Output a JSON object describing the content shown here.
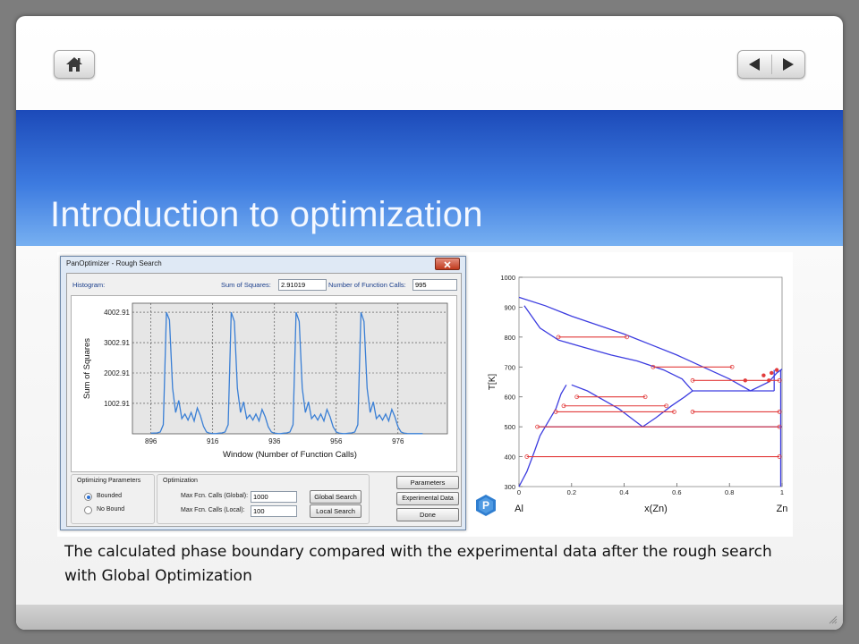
{
  "slide": {
    "title": "Introduction to optimization",
    "caption": "The calculated phase boundary compared with the experimental data after the rough search with Global Optimization"
  },
  "nav": {
    "home_icon": "home-icon",
    "prev_icon": "triangle-left-icon",
    "next_icon": "triangle-right-icon"
  },
  "window": {
    "title": "PanOptimizer - Rough Search",
    "histogram_label": "Histogram:",
    "sum_of_squares_label": "Sum of Squares:",
    "sum_of_squares_value": "2.91019",
    "function_calls_label": "Number of Function Calls:",
    "function_calls_value": "995",
    "optimizing_parameters_label": "Optimizing Parameters",
    "radio_bounded": "Bounded",
    "radio_no_bound": "No Bound",
    "optimization_label": "Optimization",
    "max_global_label": "Max Fcn. Calls (Global):",
    "max_global_value": "1000",
    "max_local_label": "Max Fcn. Calls (Local):",
    "max_local_value": "100",
    "btn_global": "Global Search",
    "btn_local": "Local Search",
    "btn_parameters": "Parameters",
    "btn_experimental": "Experimental Data",
    "btn_done": "Done"
  },
  "chart_data": [
    {
      "type": "line",
      "xlabel": "Window (Number of Function Calls)",
      "ylabel": "Sum of Squares",
      "xticks": [
        "896",
        "916",
        "936",
        "956",
        "976"
      ],
      "yticks": [
        "4002.91",
        "3002.91",
        "2002.91",
        "1002.91"
      ],
      "xlim": [
        890,
        992
      ],
      "ylim": [
        0,
        4300
      ],
      "series": [
        {
          "x": [
            896,
            898,
            899,
            900,
            901,
            902,
            903,
            904,
            905,
            906,
            907,
            908,
            909,
            910,
            911,
            912,
            913,
            914,
            915,
            916,
            917,
            918,
            919,
            920,
            921,
            922,
            923,
            924,
            925,
            926,
            927,
            928,
            929,
            930,
            931,
            932,
            933,
            934,
            935,
            936,
            937,
            938,
            939,
            940,
            941,
            942,
            943,
            944,
            945,
            946,
            947,
            948,
            949,
            950,
            951,
            952,
            953,
            954,
            955,
            956,
            957,
            958,
            959,
            960,
            961,
            962,
            963,
            964,
            965,
            966,
            967,
            968,
            969,
            970,
            971,
            972,
            973,
            974,
            975,
            976,
            977,
            978,
            979,
            980,
            981,
            982,
            983,
            984
          ],
          "y": [
            20,
            30,
            60,
            300,
            4000,
            3750,
            1500,
            700,
            1100,
            500,
            650,
            450,
            700,
            420,
            850,
            600,
            250,
            60,
            20,
            10,
            5,
            20,
            30,
            60,
            300,
            4000,
            3700,
            1500,
            700,
            1050,
            500,
            620,
            450,
            650,
            420,
            800,
            560,
            230,
            60,
            20,
            10,
            5,
            20,
            30,
            60,
            300,
            4000,
            3700,
            1500,
            700,
            1050,
            500,
            620,
            450,
            650,
            420,
            800,
            560,
            230,
            60,
            20,
            10,
            5,
            20,
            30,
            60,
            300,
            4000,
            3700,
            1500,
            700,
            1050,
            500,
            620,
            450,
            650,
            420,
            800,
            560,
            230,
            60,
            20,
            10,
            5,
            5,
            5,
            5,
            5
          ]
        }
      ]
    },
    {
      "type": "line",
      "xlabel": "x(Zn)",
      "ylabel": "T[K]",
      "xlim": [
        0,
        1
      ],
      "ylim": [
        300,
        1000
      ],
      "xticks": [
        "0",
        "0.2",
        "0.4",
        "0.6",
        "0.8",
        "1"
      ],
      "yticks": [
        "300",
        "400",
        "500",
        "600",
        "700",
        "800",
        "900",
        "1000"
      ],
      "x_end_labels": [
        "Al",
        "Zn"
      ],
      "colors": {
        "calculated": "#3d3de0",
        "experimental": "#e23c3c"
      },
      "calculated_boundaries": [
        {
          "x": [
            0,
            0.1,
            0.2,
            0.3,
            0.4,
            0.5,
            0.6,
            0.7,
            0.8,
            0.88,
            0.95,
            0.98,
            1.0
          ],
          "y": [
            933,
            905,
            870,
            840,
            810,
            775,
            740,
            700,
            660,
            620,
            650,
            680,
            693
          ]
        },
        {
          "x": [
            0.02,
            0.08,
            0.15,
            0.25,
            0.35,
            0.45,
            0.55,
            0.62,
            0.66
          ],
          "y": [
            905,
            830,
            790,
            765,
            740,
            720,
            690,
            660,
            620
          ]
        },
        {
          "x": [
            0.0,
            0.03,
            0.06,
            0.08,
            0.1,
            0.14,
            0.16,
            0.18
          ],
          "y": [
            300,
            350,
            420,
            470,
            500,
            560,
            610,
            640
          ]
        },
        {
          "x": [
            0.2,
            0.26,
            0.32,
            0.38,
            0.44,
            0.47
          ],
          "y": [
            640,
            620,
            590,
            560,
            520,
            500
          ]
        },
        {
          "x": [
            0.47,
            0.52,
            0.58,
            0.63,
            0.66
          ],
          "y": [
            500,
            530,
            570,
            600,
            620
          ]
        },
        {
          "x": [
            0.08,
            1.0
          ],
          "y": [
            500,
            500
          ]
        },
        {
          "x": [
            0.66,
            0.97
          ],
          "y": [
            620,
            620
          ]
        },
        {
          "x": [
            0.97,
            0.97
          ],
          "y": [
            620,
            690
          ]
        },
        {
          "x": [
            0.995,
            0.995
          ],
          "y": [
            300,
            690
          ]
        }
      ],
      "experimental_tielines": [
        {
          "x": [
            0.15,
            0.41
          ],
          "y": [
            800,
            800
          ]
        },
        {
          "x": [
            0.51,
            0.81
          ],
          "y": [
            700,
            700
          ]
        },
        {
          "x": [
            0.22,
            0.48
          ],
          "y": [
            600,
            600
          ]
        },
        {
          "x": [
            0.17,
            0.56
          ],
          "y": [
            570,
            570
          ]
        },
        {
          "x": [
            0.14,
            0.59
          ],
          "y": [
            550,
            550
          ]
        },
        {
          "x": [
            0.07,
            0.99
          ],
          "y": [
            500,
            500
          ]
        },
        {
          "x": [
            0.03,
            0.99
          ],
          "y": [
            400,
            400
          ]
        },
        {
          "x": [
            0.66,
            0.99
          ],
          "y": [
            655,
            655
          ]
        },
        {
          "x": [
            0.66,
            0.99
          ],
          "y": [
            550,
            550
          ]
        }
      ],
      "experimental_points": [
        {
          "x": 0.86,
          "y": 655
        },
        {
          "x": 0.95,
          "y": 655
        },
        {
          "x": 0.93,
          "y": 672
        },
        {
          "x": 0.96,
          "y": 680
        },
        {
          "x": 0.98,
          "y": 690
        }
      ]
    }
  ]
}
